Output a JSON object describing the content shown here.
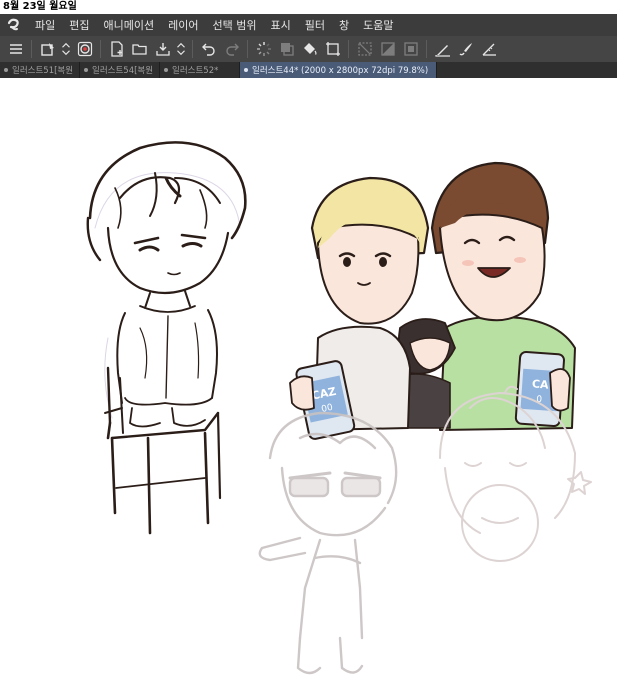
{
  "status_bar": {
    "date": "8월 23일 월요일"
  },
  "menu": {
    "items": [
      "파일",
      "편집",
      "애니메이션",
      "레이어",
      "선택 범위",
      "표시",
      "필터",
      "창",
      "도움말"
    ]
  },
  "toolbar": {
    "icons": [
      "menu-icon",
      "layer-property-icon",
      "stepper-icon",
      "color-wheel-icon",
      "new-canvas-icon",
      "open-folder-icon",
      "save-icon",
      "stepper-icon",
      "undo-icon",
      "redo-icon",
      "loading-spinner-icon",
      "copy-layer-icon",
      "fill-icon",
      "transform-icon",
      "clear-icon",
      "fill-selection-icon",
      "select-all-icon",
      "pen-icon",
      "brush-icon",
      "ruler-icon"
    ]
  },
  "tabs": [
    {
      "label": "일러스트51[복원",
      "active": false
    },
    {
      "label": "일러스트54[복원",
      "active": false
    },
    {
      "label": "일러스트52*",
      "active": false
    },
    {
      "label": "일러스트44* (2000 x 2800px 72dpi 79.8%)",
      "active": true
    }
  ],
  "canvas": {
    "can_label": "CAZ\n00",
    "colors": {
      "background": "#ffffff",
      "line": "#2b1d18",
      "sketch": "#c9c2c2",
      "blonde_hair": "#f3e6a5",
      "brown_hair": "#7a4b31",
      "skin": "#fbe6dc",
      "green_shirt": "#b8e0a3",
      "can_blue": "#8fb3dd"
    }
  }
}
